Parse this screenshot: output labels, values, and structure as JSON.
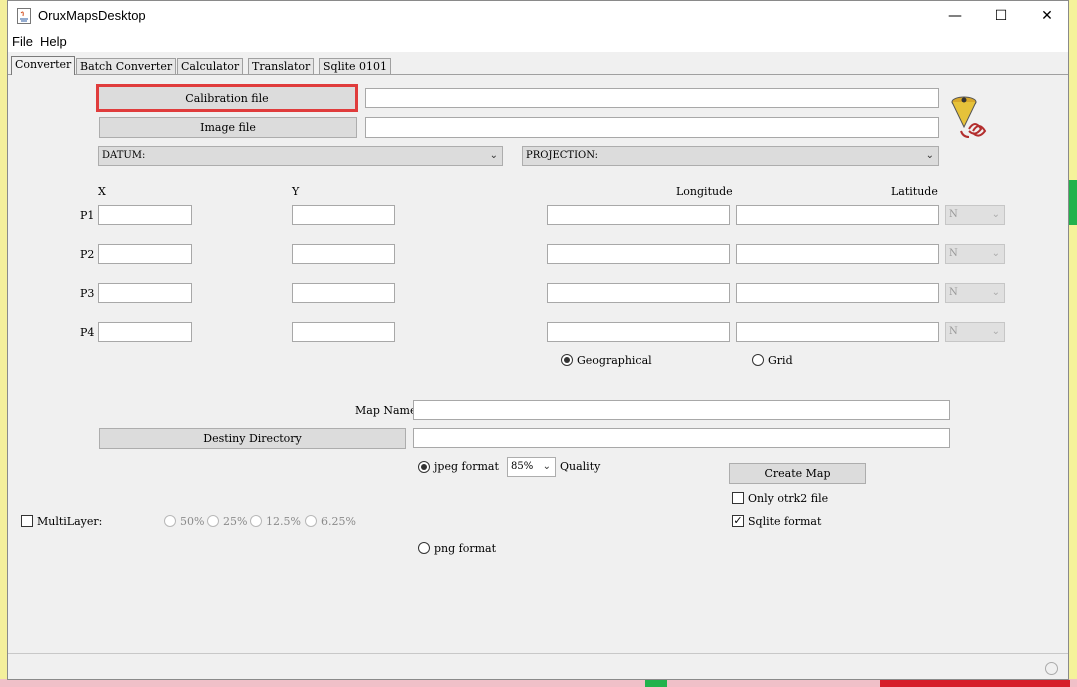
{
  "window": {
    "title": "OruxMapsDesktop",
    "controls": {
      "minimize": "—",
      "maximize": "☐",
      "close": "✕"
    }
  },
  "menu": [
    "File",
    "Help"
  ],
  "tabs": [
    "Converter",
    "Batch Converter",
    "Calculator",
    "Translator",
    "Sqlite 0101"
  ],
  "converter": {
    "calibration_button": "Calibration file",
    "image_button": "Image file",
    "datum_combo": "DATUM:",
    "projection_combo": "PROJECTION:",
    "col_x": "X",
    "col_y": "Y",
    "col_longitude": "Longitude",
    "col_latitude": "Latitude",
    "points": [
      {
        "label": "P1",
        "hemisphere": "N"
      },
      {
        "label": "P2",
        "hemisphere": "N"
      },
      {
        "label": "P3",
        "hemisphere": "N"
      },
      {
        "label": "P4",
        "hemisphere": "N"
      }
    ],
    "coord_mode": {
      "geographical": "Geographical",
      "grid": "Grid",
      "selected": "geographical"
    },
    "map_name_label": "Map Name",
    "destiny_button": "Destiny Directory",
    "jpeg_label": "jpeg format",
    "quality_value": "85%",
    "quality_label": "Quality",
    "png_label": "png format",
    "create_map_button": "Create Map",
    "only_otrk2_label": "Only otrk2 file",
    "only_otrk2_checked": false,
    "sqlite_label": "Sqlite format",
    "sqlite_checked": true,
    "multilayer_label": "MultiLayer:",
    "multilayer_checked": false,
    "multilayer_options": [
      "50%",
      "25%",
      "12.5%",
      "6.25%"
    ]
  }
}
